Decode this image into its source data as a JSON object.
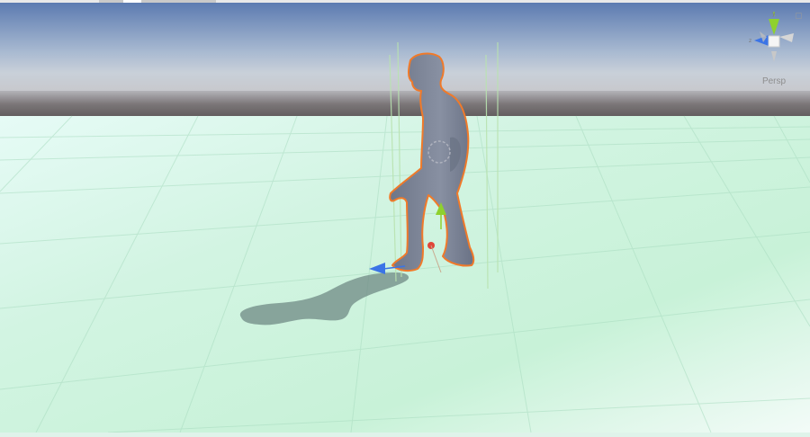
{
  "window": {
    "view_mode": "Persp"
  },
  "scene": {
    "selected_object": "humanoid-character",
    "colors": {
      "sky_top": "#5f7fb3",
      "horizon_dark": "#6a6668",
      "ground": "#d5f5e3",
      "character": "#7a8294",
      "selection_outline": "#f07a2a",
      "gizmo_y": "#8fd12e",
      "gizmo_x": "#e0473a",
      "gizmo_z": "#3b74e6"
    },
    "icons": {
      "view_gizmo": "axis-gizmo-icon",
      "lock": "lock-icon"
    }
  }
}
